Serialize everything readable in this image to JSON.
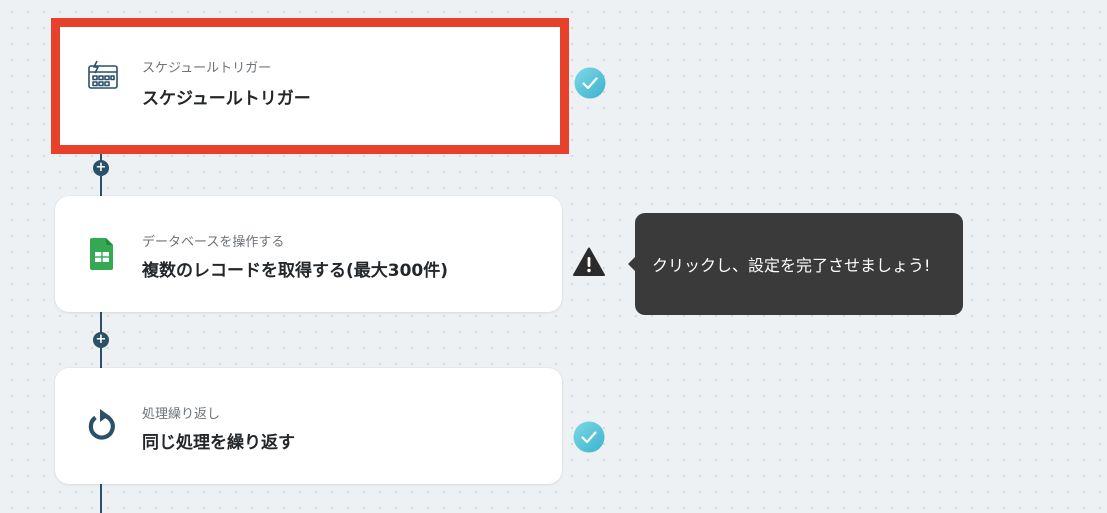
{
  "steps": [
    {
      "label": "スケジュールトリガー",
      "title": "スケジュールトリガー",
      "icon": "schedule-calendar-icon",
      "status": "completed",
      "selected": true
    },
    {
      "label": "データベースを操作する",
      "title": "複数のレコードを取得する(最大300件)",
      "icon": "google-sheets-icon",
      "status": "warning",
      "selected": false
    },
    {
      "label": "処理繰り返し",
      "title": "同じ処理を繰り返す",
      "icon": "loop-icon",
      "status": "completed",
      "selected": false
    }
  ],
  "tooltip": {
    "text": "クリックし、設定を完了させましょう!"
  },
  "add_node": {
    "symbol": "+"
  },
  "colors": {
    "selected_border": "#e8412b",
    "completed": "#5ec6d9",
    "warning": "#2b2b2b",
    "connector": "#2a5168",
    "sheets_green": "#34a853",
    "loop_icon": "#2a5168"
  }
}
